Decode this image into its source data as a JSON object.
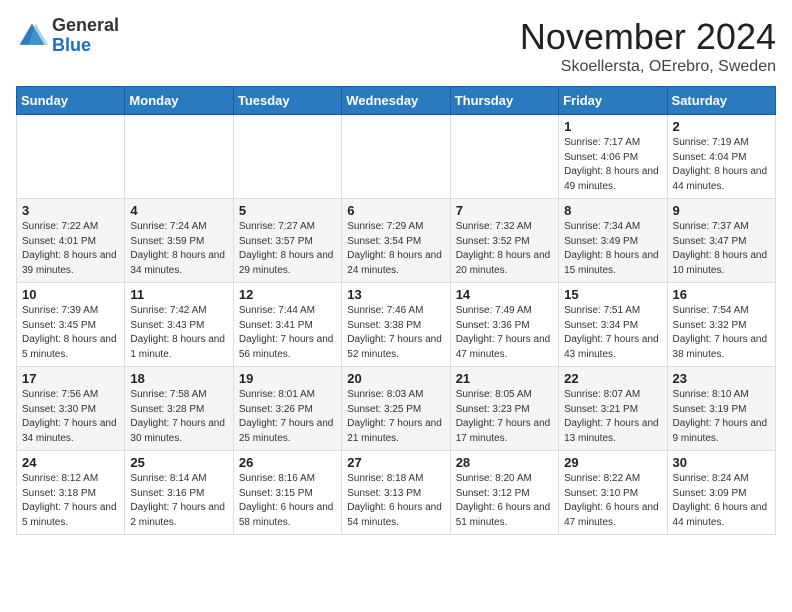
{
  "header": {
    "logo_general": "General",
    "logo_blue": "Blue",
    "title": "November 2024",
    "location": "Skoellersta, OErebro, Sweden"
  },
  "days_of_week": [
    "Sunday",
    "Monday",
    "Tuesday",
    "Wednesday",
    "Thursday",
    "Friday",
    "Saturday"
  ],
  "weeks": [
    [
      {
        "day": "",
        "info": ""
      },
      {
        "day": "",
        "info": ""
      },
      {
        "day": "",
        "info": ""
      },
      {
        "day": "",
        "info": ""
      },
      {
        "day": "",
        "info": ""
      },
      {
        "day": "1",
        "info": "Sunrise: 7:17 AM\nSunset: 4:06 PM\nDaylight: 8 hours and 49 minutes."
      },
      {
        "day": "2",
        "info": "Sunrise: 7:19 AM\nSunset: 4:04 PM\nDaylight: 8 hours and 44 minutes."
      }
    ],
    [
      {
        "day": "3",
        "info": "Sunrise: 7:22 AM\nSunset: 4:01 PM\nDaylight: 8 hours and 39 minutes."
      },
      {
        "day": "4",
        "info": "Sunrise: 7:24 AM\nSunset: 3:59 PM\nDaylight: 8 hours and 34 minutes."
      },
      {
        "day": "5",
        "info": "Sunrise: 7:27 AM\nSunset: 3:57 PM\nDaylight: 8 hours and 29 minutes."
      },
      {
        "day": "6",
        "info": "Sunrise: 7:29 AM\nSunset: 3:54 PM\nDaylight: 8 hours and 24 minutes."
      },
      {
        "day": "7",
        "info": "Sunrise: 7:32 AM\nSunset: 3:52 PM\nDaylight: 8 hours and 20 minutes."
      },
      {
        "day": "8",
        "info": "Sunrise: 7:34 AM\nSunset: 3:49 PM\nDaylight: 8 hours and 15 minutes."
      },
      {
        "day": "9",
        "info": "Sunrise: 7:37 AM\nSunset: 3:47 PM\nDaylight: 8 hours and 10 minutes."
      }
    ],
    [
      {
        "day": "10",
        "info": "Sunrise: 7:39 AM\nSunset: 3:45 PM\nDaylight: 8 hours and 5 minutes."
      },
      {
        "day": "11",
        "info": "Sunrise: 7:42 AM\nSunset: 3:43 PM\nDaylight: 8 hours and 1 minute."
      },
      {
        "day": "12",
        "info": "Sunrise: 7:44 AM\nSunset: 3:41 PM\nDaylight: 7 hours and 56 minutes."
      },
      {
        "day": "13",
        "info": "Sunrise: 7:46 AM\nSunset: 3:38 PM\nDaylight: 7 hours and 52 minutes."
      },
      {
        "day": "14",
        "info": "Sunrise: 7:49 AM\nSunset: 3:36 PM\nDaylight: 7 hours and 47 minutes."
      },
      {
        "day": "15",
        "info": "Sunrise: 7:51 AM\nSunset: 3:34 PM\nDaylight: 7 hours and 43 minutes."
      },
      {
        "day": "16",
        "info": "Sunrise: 7:54 AM\nSunset: 3:32 PM\nDaylight: 7 hours and 38 minutes."
      }
    ],
    [
      {
        "day": "17",
        "info": "Sunrise: 7:56 AM\nSunset: 3:30 PM\nDaylight: 7 hours and 34 minutes."
      },
      {
        "day": "18",
        "info": "Sunrise: 7:58 AM\nSunset: 3:28 PM\nDaylight: 7 hours and 30 minutes."
      },
      {
        "day": "19",
        "info": "Sunrise: 8:01 AM\nSunset: 3:26 PM\nDaylight: 7 hours and 25 minutes."
      },
      {
        "day": "20",
        "info": "Sunrise: 8:03 AM\nSunset: 3:25 PM\nDaylight: 7 hours and 21 minutes."
      },
      {
        "day": "21",
        "info": "Sunrise: 8:05 AM\nSunset: 3:23 PM\nDaylight: 7 hours and 17 minutes."
      },
      {
        "day": "22",
        "info": "Sunrise: 8:07 AM\nSunset: 3:21 PM\nDaylight: 7 hours and 13 minutes."
      },
      {
        "day": "23",
        "info": "Sunrise: 8:10 AM\nSunset: 3:19 PM\nDaylight: 7 hours and 9 minutes."
      }
    ],
    [
      {
        "day": "24",
        "info": "Sunrise: 8:12 AM\nSunset: 3:18 PM\nDaylight: 7 hours and 5 minutes."
      },
      {
        "day": "25",
        "info": "Sunrise: 8:14 AM\nSunset: 3:16 PM\nDaylight: 7 hours and 2 minutes."
      },
      {
        "day": "26",
        "info": "Sunrise: 8:16 AM\nSunset: 3:15 PM\nDaylight: 6 hours and 58 minutes."
      },
      {
        "day": "27",
        "info": "Sunrise: 8:18 AM\nSunset: 3:13 PM\nDaylight: 6 hours and 54 minutes."
      },
      {
        "day": "28",
        "info": "Sunrise: 8:20 AM\nSunset: 3:12 PM\nDaylight: 6 hours and 51 minutes."
      },
      {
        "day": "29",
        "info": "Sunrise: 8:22 AM\nSunset: 3:10 PM\nDaylight: 6 hours and 47 minutes."
      },
      {
        "day": "30",
        "info": "Sunrise: 8:24 AM\nSunset: 3:09 PM\nDaylight: 6 hours and 44 minutes."
      }
    ]
  ]
}
